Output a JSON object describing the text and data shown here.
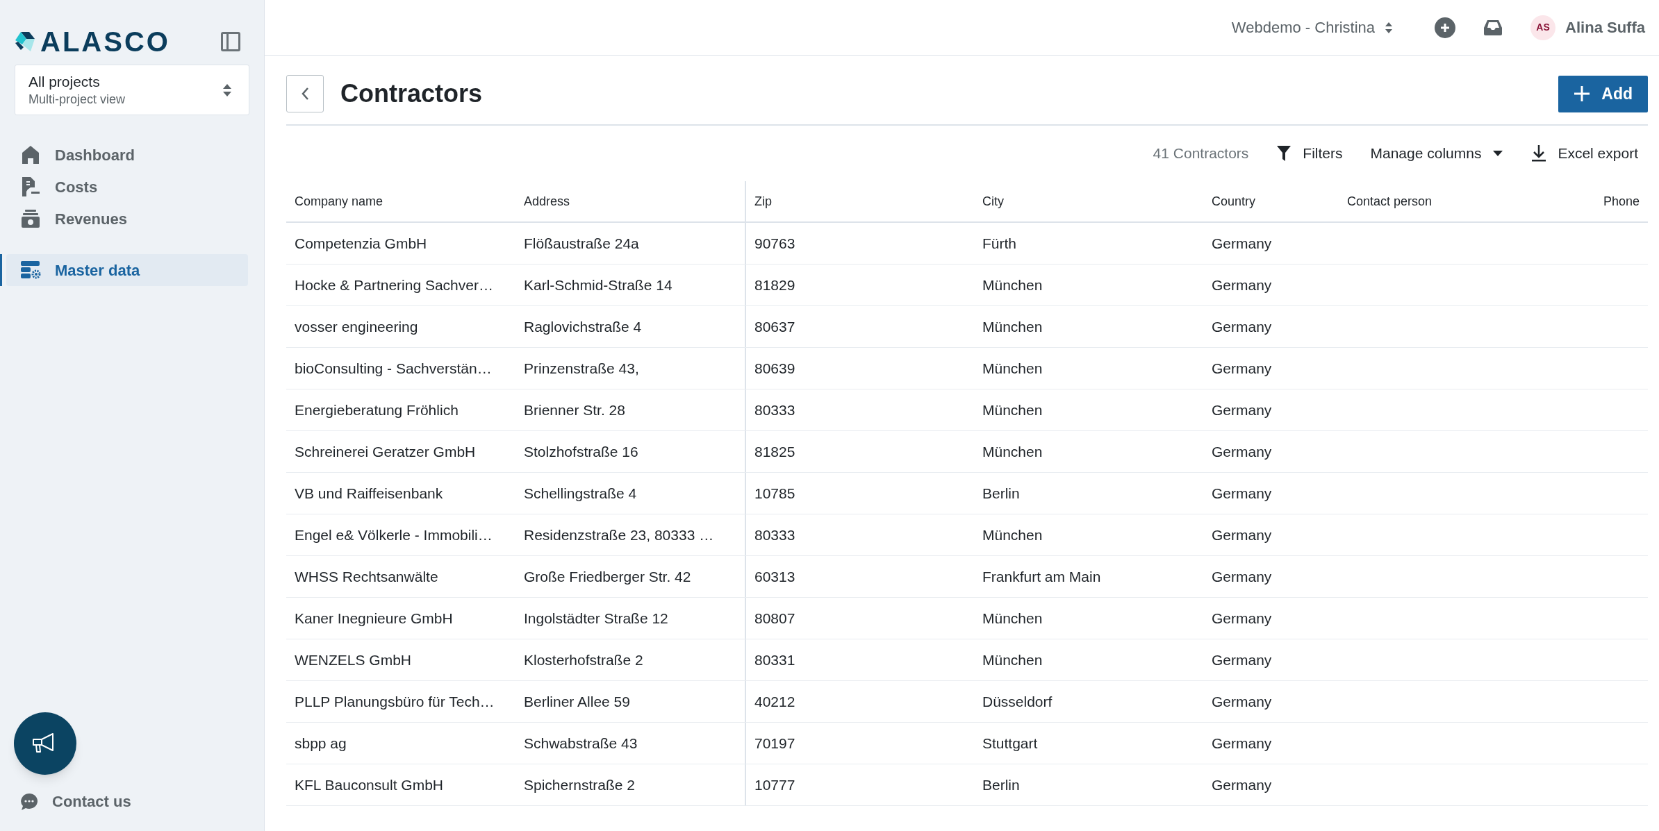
{
  "sidebar": {
    "logo": "ALASCO",
    "project_selector": {
      "title": "All projects",
      "subtitle": "Multi-project view"
    },
    "nav": [
      {
        "kind": "home",
        "label": "Dashboard",
        "selected": false
      },
      {
        "kind": "costs",
        "label": "Costs",
        "selected": false
      },
      {
        "kind": "revenues",
        "label": "Revenues",
        "selected": false
      },
      {
        "kind": "master",
        "label": "Master data",
        "selected": true
      }
    ],
    "contact": "Contact us"
  },
  "topbar": {
    "workspace": "Webdemo - Christina",
    "user": {
      "initials": "AS",
      "name": "Alina Suffa"
    }
  },
  "page": {
    "title": "Contractors",
    "add_button": "Add",
    "count": "41 Contractors",
    "actions": [
      {
        "kind": "filter",
        "label": "Filters"
      },
      {
        "kind": "columns",
        "label": "Manage columns"
      },
      {
        "kind": "export",
        "label": "Excel export"
      }
    ]
  },
  "table": {
    "columns": [
      "Company name",
      "Address",
      "Zip",
      "City",
      "Country",
      "Contact person",
      "Phone"
    ],
    "rows": [
      [
        "Competenzia GmbH",
        "Flößaustraße 24a",
        "90763",
        "Fürth",
        "Germany"
      ],
      [
        "Hocke & Partnering Sachver…",
        "Karl-Schmid-Straße 14",
        "81829",
        "München",
        "Germany"
      ],
      [
        "vosser engineering",
        "Raglovichstraße 4",
        "80637",
        "München",
        "Germany"
      ],
      [
        "bioConsulting - Sachverstän…",
        "Prinzenstraße 43,",
        "80639",
        "München",
        "Germany"
      ],
      [
        "Energieberatung Fröhlich",
        "Brienner Str. 28",
        "80333",
        "München",
        "Germany"
      ],
      [
        "Schreinerei Geratzer GmbH",
        "Stolzhofstraße 16",
        "81825",
        "München",
        "Germany"
      ],
      [
        "VB und Raiffeisenbank",
        "Schellingstraße 4",
        "10785",
        "Berlin",
        "Germany"
      ],
      [
        "Engel e& Völkerle - Immobili…",
        "Residenzstraße 23, 80333 …",
        "80333",
        "München",
        "Germany"
      ],
      [
        "WHSS Rechtsanwälte",
        "Große Friedberger Str. 42",
        "60313",
        "Frankfurt am Main",
        "Germany"
      ],
      [
        "Kaner Inegnieure GmbH",
        "Ingolstädter Straße 12",
        "80807",
        "München",
        "Germany"
      ],
      [
        "WENZELS GmbH",
        "Klosterhofstraße 2",
        "80331",
        "München",
        "Germany"
      ],
      [
        "PLLP Planungsbüro für Tech…",
        "Berliner Allee 59",
        "40212",
        "Düsseldorf",
        "Germany"
      ],
      [
        "sbpp ag",
        "Schwabstraße 43",
        "70197",
        "Stuttgart",
        "Germany"
      ],
      [
        "KFL Bauconsult GmbH",
        "Spichernstraße 2",
        "10777",
        "Berlin",
        "Germany"
      ]
    ]
  }
}
